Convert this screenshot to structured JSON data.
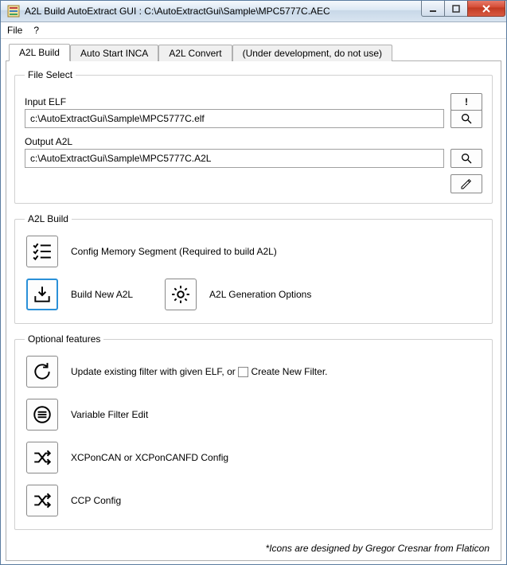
{
  "window": {
    "title": "A2L Build AutoExtract GUI : C:\\AutoExtractGui\\Sample\\MPC5777C.AEC"
  },
  "menu": {
    "file": "File",
    "help": "?"
  },
  "tabs": [
    {
      "label": "A2L Build",
      "active": true
    },
    {
      "label": "Auto Start INCA",
      "active": false
    },
    {
      "label": "A2L Convert",
      "active": false
    },
    {
      "label": "(Under development, do not use)",
      "active": false
    }
  ],
  "fileSelect": {
    "legend": "File Select",
    "exclaim": "!",
    "inputElfLabel": "Input ELF",
    "inputElfValue": "c:\\AutoExtractGui\\Sample\\MPC5777C.elf",
    "outputA2lLabel": "Output A2L",
    "outputA2lValue": "c:\\AutoExtractGui\\Sample\\MPC5777C.A2L"
  },
  "a2lBuild": {
    "legend": "A2L Build",
    "configMemSeg": "Config Memory Segment (Required to build A2L)",
    "buildNew": "Build New A2L",
    "genOptions": "A2L Generation Options"
  },
  "optional": {
    "legend": "Optional features",
    "updateFilterPrefix": "Update existing filter with given ELF, or ",
    "createNewFilter": " Create New Filter.",
    "variableFilterEdit": "Variable Filter Edit",
    "xcpConfig": "XCPonCAN or XCPonCANFD Config",
    "ccpConfig": "CCP Config"
  },
  "footer": "*Icons are designed by Gregor Cresnar from Flaticon"
}
